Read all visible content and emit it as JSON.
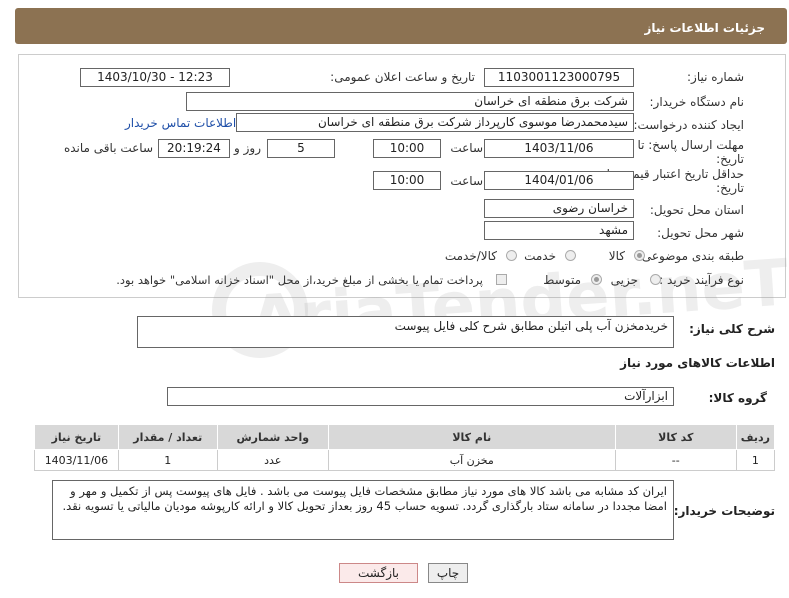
{
  "header": {
    "title": "جزئیات اطلاعات نیاز"
  },
  "form": {
    "need_number_label": "شماره نیاز:",
    "need_number": "1103001123000795",
    "announce_label": "تاریخ و ساعت اعلان عمومی:",
    "announce_value": "1403/10/30 - 12:23",
    "buyer_org_label": "نام دستگاه خریدار:",
    "buyer_org": "شرکت برق منطقه ای خراسان",
    "creator_label": "ایجاد کننده درخواست:",
    "creator": "سیدمحمدرضا موسوی کارپرداز شرکت برق منطقه ای خراسان",
    "contact_link": "اطلاعات تماس خریدار",
    "deadline_label_1": "مهلت ارسال پاسخ: تا",
    "deadline_label_2": "تاریخ:",
    "deadline_date": "1403/11/06",
    "time_label": "ساعت",
    "deadline_time": "10:00",
    "days_value": "5",
    "days_label": "روز و",
    "remaining_time": "20:19:24",
    "remaining_label": "ساعت باقی مانده",
    "validity_label_1": "حداقل تاریخ اعتبار قیمت: تا",
    "validity_label_2": "تاریخ:",
    "validity_date": "1404/01/06",
    "validity_time_label": "ساعت",
    "validity_time": "10:00",
    "province_label": "استان محل تحویل:",
    "province": "خراسان رضوی",
    "city_label": "شهر محل تحویل:",
    "city": "مشهد",
    "category_label": "طبقه بندی موضوعی:",
    "category_options": [
      "کالا",
      "خدمت",
      "کالا/خدمت"
    ],
    "process_label": "نوع فرآیند خرید :",
    "process_options": [
      "جزیی",
      "متوسط"
    ],
    "payment_text": "پرداخت تمام یا بخشی از مبلغ خرید،از محل \"اسناد خزانه اسلامی\" خواهد بود."
  },
  "summary": {
    "label": "شرح کلی نیاز:",
    "value": "خریدمخزن آب پلی اتیلن مطابق شرح کلی فایل پیوست"
  },
  "goods": {
    "section_title": "اطلاعات کالاهای مورد نیاز",
    "group_label": "گروه کالا:",
    "group_value": "ابزارآلات",
    "columns": [
      "ردیف",
      "کد کالا",
      "نام کالا",
      "واحد شمارش",
      "تعداد / مقدار",
      "تاریخ نیاز"
    ],
    "rows": [
      [
        "1",
        "--",
        "مخزن آب",
        "عدد",
        "1",
        "1403/11/06"
      ]
    ]
  },
  "notes": {
    "label": "توضیحات خریدار:",
    "text": "ایران کد مشابه می باشد کالا های مورد نیاز مطابق مشخصات فایل پیوست می باشد . فایل های پیوست پس از تکمیل و مهر و امضا مجددا در سامانه ستاد بارگذاری گردد. تسویه حساب 45 روز بعداز تحویل کالا و ارائه کارپوشه مودیان مالیاتی یا تسویه نقد."
  },
  "buttons": {
    "print": "چاپ",
    "back": "بازگشت"
  },
  "watermark": "AriaTender.neT",
  "colors": {
    "header_bg": "#8c7252",
    "link": "#1f4fa8",
    "back_button_border": "#c88"
  }
}
